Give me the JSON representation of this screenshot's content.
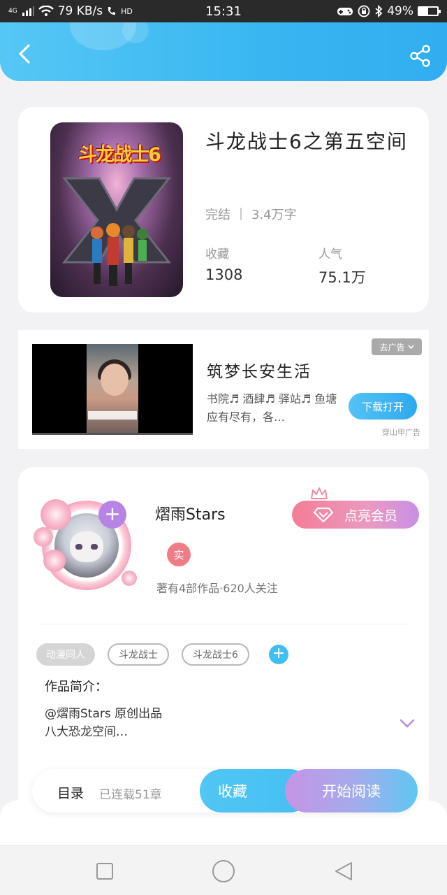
{
  "status_bar": {
    "network": "4G",
    "speed": "79 KB/s",
    "hd": "HD",
    "time": "15:31",
    "battery": "49%",
    "battery_level": 0.49
  },
  "header": {
    "back_icon": "chevron-left-icon",
    "share_icon": "share-icon"
  },
  "book": {
    "title": "斗龙战士6之第五空间",
    "cover_text": "斗龙战士6",
    "status": "完结",
    "word_count": "3.4万字",
    "favorites_label": "收藏",
    "favorites_value": "1308",
    "popularity_label": "人气",
    "popularity_value": "75.1万"
  },
  "ad": {
    "title": "筑梦长安生活",
    "description": "书院♬ 酒肆♬ 驿站♬ 鱼塘应有尽有，各…",
    "close_label": "去广告",
    "download_label": "下载打开",
    "source": "穿山甲广告"
  },
  "author": {
    "name": "熠雨Stars",
    "verified_badge": "实",
    "vip_label": "点亮会员",
    "stats": "著有4部作品·620人关注",
    "follow_label": "+",
    "tags": [
      "动漫同人",
      "斗龙战士",
      "斗龙战士6"
    ],
    "tag_add_label": "+",
    "intro_label": "作品简介：",
    "intro_line1": "@熠雨Stars 原创出品",
    "intro_line2": "八大恐龙空间…"
  },
  "bottom_bar": {
    "toc_label": "目录",
    "serial_status": "已连载51章",
    "favorite_label": "收藏",
    "read_label": "开始阅读"
  },
  "colors": {
    "accent_blue": "#38b6f1",
    "accent_pink": "#f57d98",
    "accent_purple": "#b784e6"
  }
}
